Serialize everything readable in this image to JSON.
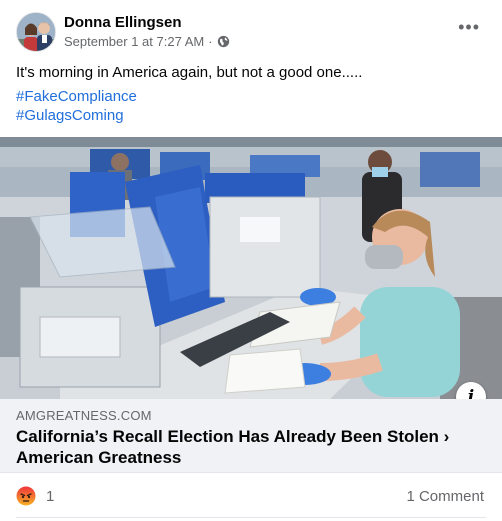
{
  "post": {
    "author": "Donna Ellingsen",
    "timestamp": "September 1 at 7:27 AM",
    "separator": "·",
    "privacy_icon": "globe-icon",
    "more_icon": "more-horizontal-icon",
    "more_label": "•••",
    "text": "It's morning in America again, but not a good one.....",
    "hashtags": [
      "#FakeCompliance",
      "#GulagsComing"
    ]
  },
  "link_preview": {
    "domain": "AMGREATNESS.COM",
    "title": "California’s Recall Election Has Already Been Stolen › American Greatness",
    "info_label": "i"
  },
  "footer": {
    "reaction_icon": "angry-reaction-icon",
    "reaction_count": "1",
    "comments": "1 Comment"
  },
  "colors": {
    "hashtag": "#216fdb",
    "secondary_text": "#65676b",
    "link_card_bg": "#f0f2f5",
    "angry_reaction": "#e9710f"
  }
}
